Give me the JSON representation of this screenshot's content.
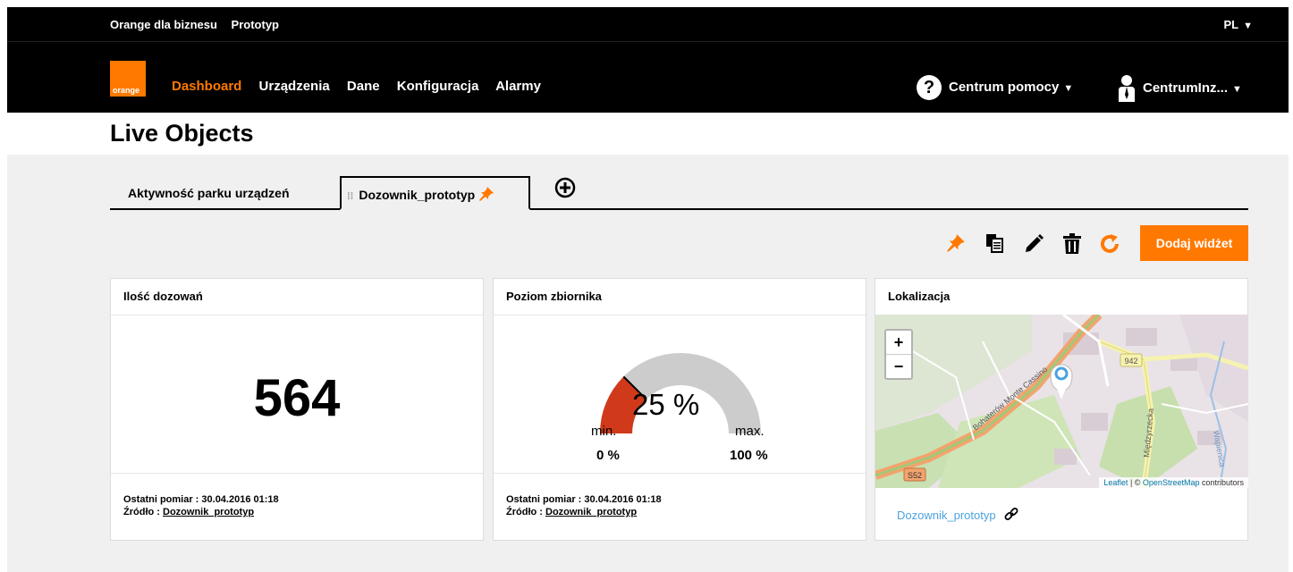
{
  "topbar": {
    "brand": "Orange dla biznesu",
    "product": "Prototyp",
    "lang": "PL"
  },
  "logo": {
    "text": "orange"
  },
  "nav": {
    "items": [
      "Dashboard",
      "Urządzenia",
      "Dane",
      "Konfiguracja",
      "Alarmy"
    ],
    "active": "Dashboard"
  },
  "help": {
    "icon": "?",
    "label": "Centrum pomocy"
  },
  "user": {
    "label": "CentrumInz..."
  },
  "page": {
    "title": "Live Objects"
  },
  "tabs": {
    "tab1": "Aktywność parku urządzeń",
    "tab2": "Dozownik_prototyp"
  },
  "toolbar": {
    "add_widget": "Dodaj widżet"
  },
  "widget1": {
    "title": "Ilość dozowań",
    "value": "564",
    "last_label": "Ostatni pomiar : 30.04.2016 01:18",
    "source_label": "Źródło :",
    "source_link": "Dozownik_prototyp"
  },
  "widget2": {
    "title": "Poziom zbiornika",
    "value": "25 %",
    "level": 0.25,
    "min_label": "min.",
    "max_label": "max.",
    "min_value": "0 %",
    "max_value": "100 %",
    "last_label": "Ostatni pomiar : 30.04.2016 01:18",
    "source_label": "Źródło :",
    "source_link": "Dozownik_prototyp"
  },
  "widget3": {
    "title": "Lokalizacja",
    "zoom_in": "+",
    "zoom_out": "−",
    "street": "Bohaterów Monte Cassino",
    "road_label": "942",
    "road_label2": "S52",
    "street2": "Międzyrzecka",
    "river": "Wapienica",
    "attrib_leaflet": "Leaflet",
    "attrib_sep": " | © ",
    "attrib_osm": "OpenStreetMap",
    "attrib_tail": " contributors",
    "device_link": "Dozownik_prototyp"
  },
  "colors": {
    "accent": "#ff7900",
    "gauge_fill": "#d03a1a",
    "gauge_bg": "#cccccc",
    "link": "#4aa3df"
  }
}
